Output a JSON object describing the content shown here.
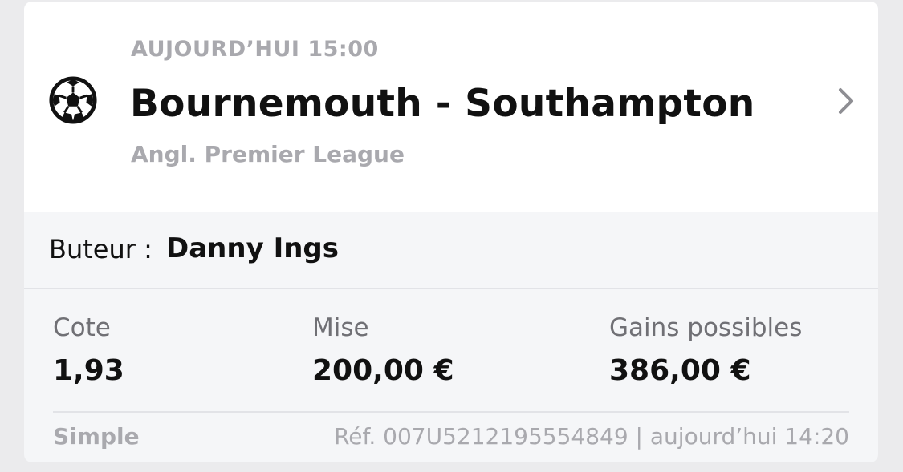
{
  "event": {
    "time": "AUJOURD’HUI 15:00",
    "title": "Bournemouth - Southampton",
    "league": "Angl. Premier League",
    "sport_icon": "soccer-ball-icon",
    "open_icon": "chevron-right-icon"
  },
  "selection": {
    "label": "Buteur :",
    "value": "Danny Ings"
  },
  "stats": {
    "odds_label": "Cote",
    "odds_value": "1,93",
    "stake_label": "Mise",
    "stake_value": "200,00 €",
    "winnings_label": "Gains possibles",
    "winnings_value": "386,00 €"
  },
  "footer": {
    "bet_type": "Simple",
    "reference": "Réf. 007U5212195554849 | aujourd’hui 14:20"
  }
}
